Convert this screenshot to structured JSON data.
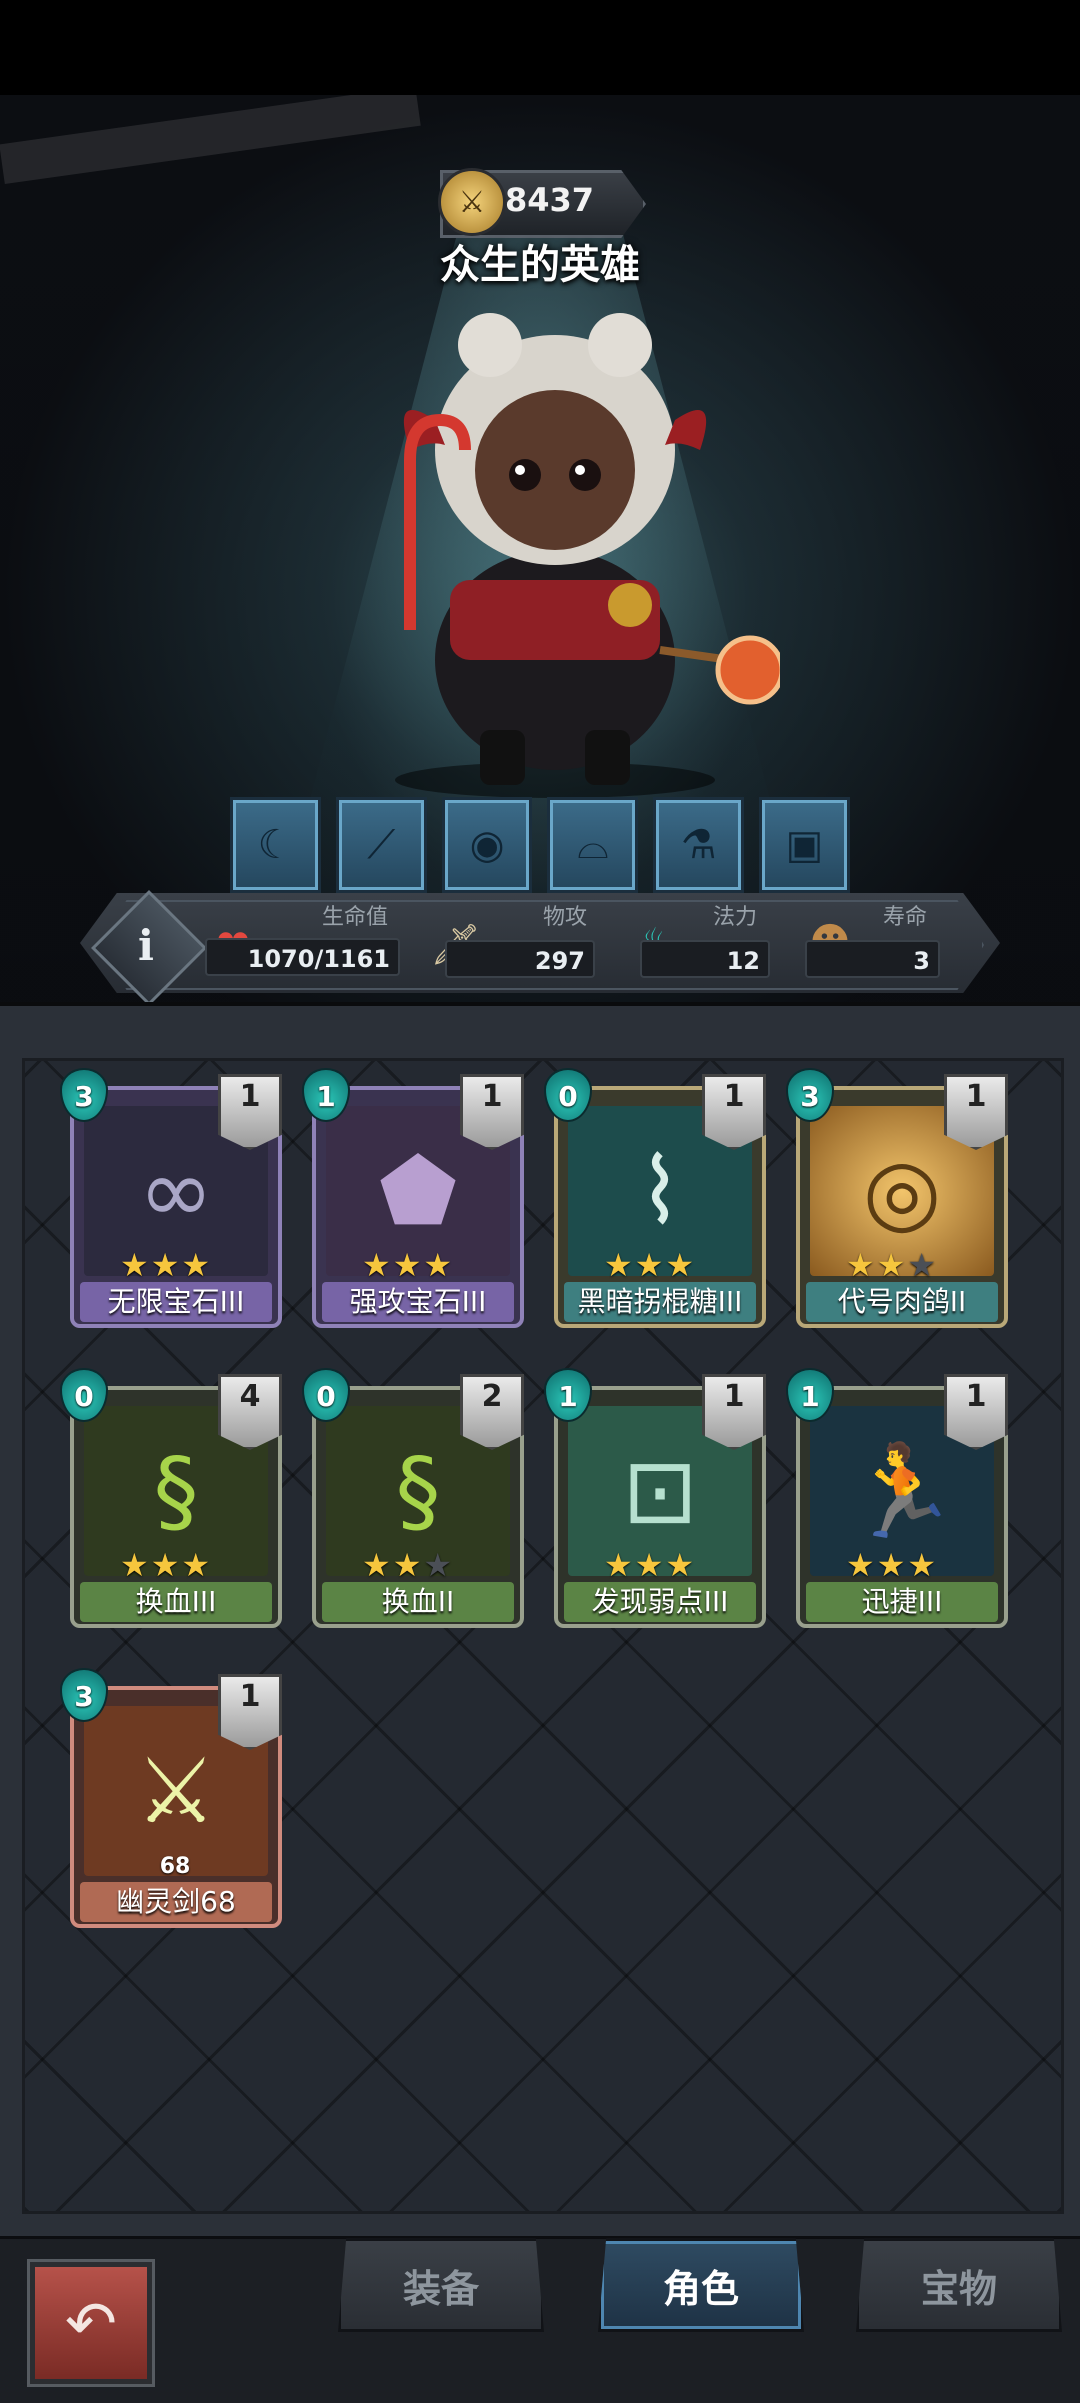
{
  "hero": {
    "power": "8437",
    "title": "众生的英雄"
  },
  "skills": [
    "hood-icon",
    "blade-icon",
    "eye-icon",
    "bat-wing-icon",
    "potion-icon",
    "box-icon"
  ],
  "stats": {
    "hp_label": "生命值",
    "hp_value": "1070/1161",
    "atk_label": "物攻",
    "atk_value": "297",
    "mana_label": "法力",
    "mana_value": "12",
    "life_label": "寿命",
    "life_value": "3"
  },
  "cards": [
    {
      "name": "无限宝石III",
      "cost": "3",
      "count": "1",
      "stars": 3,
      "max_stars": 3,
      "icon": "infinity-gem-icon"
    },
    {
      "name": "强攻宝石III",
      "cost": "1",
      "count": "1",
      "stars": 3,
      "max_stars": 3,
      "icon": "crystal-gem-icon"
    },
    {
      "name": "黑暗拐棍糖III",
      "cost": "0",
      "count": "1",
      "stars": 3,
      "max_stars": 3,
      "icon": "candy-cane-icon"
    },
    {
      "name": "代号肉鸽II",
      "cost": "3",
      "count": "1",
      "stars": 2,
      "max_stars": 3,
      "icon": "vault-icon"
    },
    {
      "name": "换血III",
      "cost": "0",
      "count": "4",
      "stars": 3,
      "max_stars": 3,
      "icon": "blood-swap-icon"
    },
    {
      "name": "换血II",
      "cost": "0",
      "count": "2",
      "stars": 2,
      "max_stars": 3,
      "icon": "blood-swap-icon"
    },
    {
      "name": "发现弱点III",
      "cost": "1",
      "count": "1",
      "stars": 3,
      "max_stars": 3,
      "icon": "robot-target-icon"
    },
    {
      "name": "迅捷III",
      "cost": "1",
      "count": "1",
      "stars": 3,
      "max_stars": 3,
      "icon": "running-man-icon"
    },
    {
      "name": "幽灵剑68",
      "cost": "3",
      "count": "1",
      "level": "68",
      "icon": "ghost-sword-icon"
    }
  ],
  "nav": {
    "back": "back-arrow-icon",
    "tab_equipment": "装备",
    "tab_character": "角色",
    "tab_treasure": "宝物"
  },
  "colors": {
    "accent": "#4e86b0",
    "mana": "#2bc7b8",
    "star": "#f6c63d",
    "back_button": "#b6524a"
  }
}
